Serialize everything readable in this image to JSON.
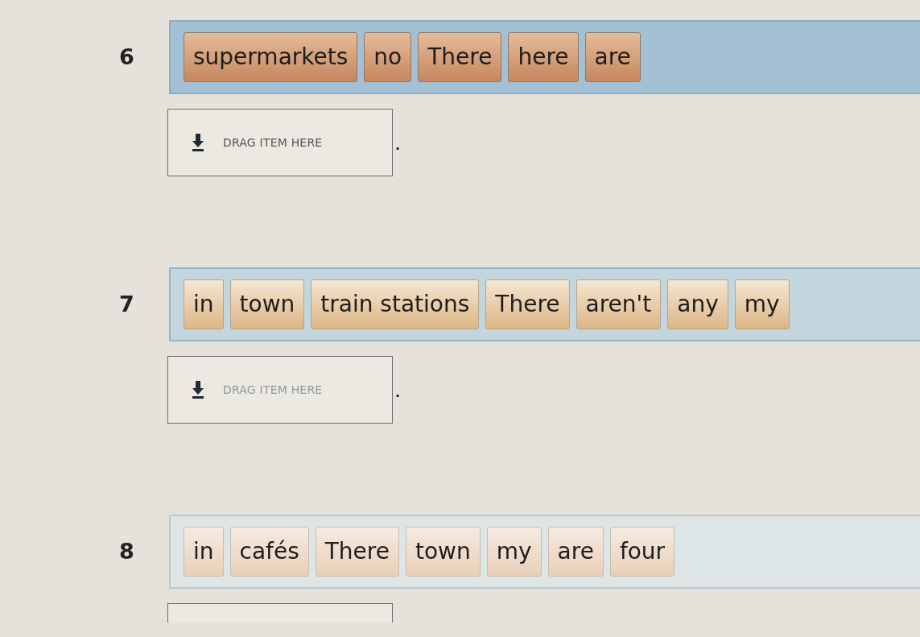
{
  "questions": [
    {
      "number": "6",
      "words": [
        "supermarkets",
        "no",
        "There",
        "here",
        "are"
      ],
      "drop_zone": {
        "placeholder": "DRAG ITEM HERE",
        "end_mark": ".",
        "cut_off": false
      }
    },
    {
      "number": "7",
      "words": [
        "in",
        "town",
        "train stations",
        "There",
        "aren't",
        "any",
        "my"
      ],
      "drop_zone": {
        "placeholder": "DRAG ITEM HERE",
        "end_mark": ".",
        "cut_off": false
      }
    },
    {
      "number": "8",
      "words": [
        "in",
        "cafés",
        "There",
        "town",
        "my",
        "are",
        "four"
      ],
      "drop_zone": {
        "cut_off": true
      }
    }
  ]
}
